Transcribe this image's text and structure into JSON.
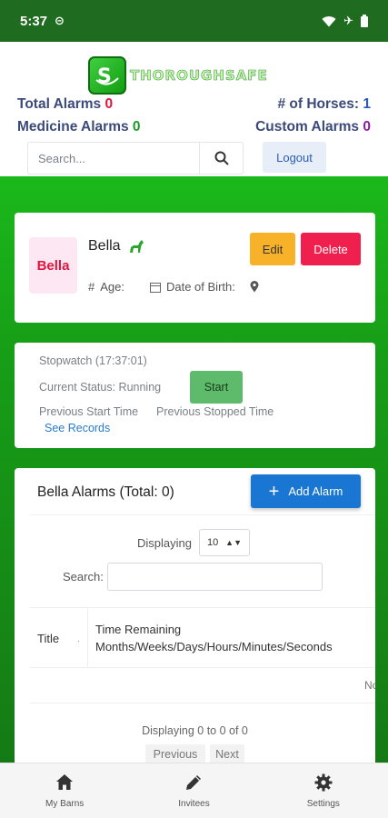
{
  "status_bar": {
    "time": "5:37",
    "icons": [
      "clock-circle-icon",
      "wifi-icon",
      "airplane-icon",
      "battery-icon"
    ]
  },
  "header": {
    "logo_text": "THOROUGHSAFE",
    "stats": {
      "total_alarms_label": "Total Alarms",
      "total_alarms_value": "0",
      "horses_label": "# of Horses:",
      "horses_value": "1",
      "medicine_alarms_label": "Medicine Alarms",
      "medicine_alarms_value": "0",
      "custom_alarms_label": "Custom Alarms",
      "custom_alarms_value": "0"
    },
    "search_placeholder": "Search...",
    "logout_label": "Logout"
  },
  "horse_card": {
    "avatar_text": "Bella",
    "name": "Bella",
    "age_label": "Age:",
    "dob_label": "Date of Birth:",
    "edit_label": "Edit",
    "delete_label": "Delete"
  },
  "stopwatch": {
    "title": "Stopwatch (17:37:01)",
    "status": "Current Status: Running",
    "start_label": "Start",
    "previous_start": "Previous Start Time",
    "previous_stopped": "Previous Stopped Time",
    "see_records": "See Records"
  },
  "alarms": {
    "title": "Bella Alarms (Total: 0)",
    "add_label": "Add Alarm",
    "displaying_label": "Displaying",
    "page_size": "10",
    "search_label": "Search:",
    "columns": [
      "Title",
      "Time Remaining",
      "Months/Weeks/Days/Hours/Minutes/Seconds"
    ],
    "no_data_text": "No",
    "paging_info": "Displaying 0 to 0 of 0",
    "previous_label": "Previous",
    "next_label": "Next"
  },
  "bottom_nav": [
    {
      "label": "My Barns",
      "icon": "home-icon"
    },
    {
      "label": "Invitees",
      "icon": "pencil-icon"
    },
    {
      "label": "Settings",
      "icon": "gear-icon"
    }
  ],
  "colors": {
    "status_bar": "#1f6b1f",
    "content_green": "#1bb91b",
    "accent_red": "#e0143c",
    "edit_yellow": "#f7b22a",
    "delete_red": "#f0204e",
    "add_blue": "#1976d2"
  }
}
